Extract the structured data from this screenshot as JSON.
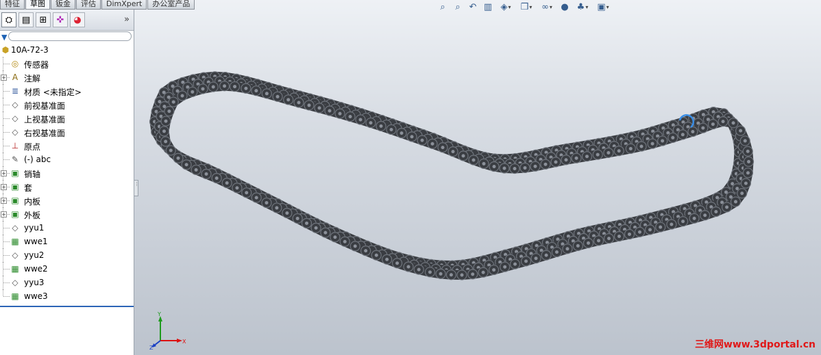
{
  "tabs": [
    {
      "label": "特征",
      "active": false
    },
    {
      "label": "草图",
      "active": true
    },
    {
      "label": "钣金",
      "active": false
    },
    {
      "label": "评估",
      "active": false
    },
    {
      "label": "DimXpert",
      "active": false
    },
    {
      "label": "办公室产品",
      "active": false
    }
  ],
  "panel": {
    "tab_icons": [
      "feature-manager-icon",
      "property-manager-icon",
      "configuration-manager-icon",
      "dimxpert-manager-icon",
      "display-manager-icon"
    ],
    "expand_glyph": "»",
    "tree": [
      {
        "label": "10A-72-3",
        "icon": "assembly-icon",
        "root": true
      },
      {
        "label": "传感器",
        "icon": "sensor-icon"
      },
      {
        "label": "注解",
        "icon": "annotation-icon",
        "expandable": true
      },
      {
        "label": "材质 <未指定>",
        "icon": "material-icon"
      },
      {
        "label": "前视基准面",
        "icon": "plane-icon"
      },
      {
        "label": "上视基准面",
        "icon": "plane-icon"
      },
      {
        "label": "右视基准面",
        "icon": "plane-icon"
      },
      {
        "label": "原点",
        "icon": "origin-icon"
      },
      {
        "label": "(-) abc",
        "icon": "sketch-icon"
      },
      {
        "label": "销轴",
        "icon": "part-icon",
        "expandable": true
      },
      {
        "label": "套",
        "icon": "part-icon",
        "expandable": true
      },
      {
        "label": "内板",
        "icon": "part-icon",
        "expandable": true
      },
      {
        "label": "外板",
        "icon": "part-icon",
        "expandable": true
      },
      {
        "label": "yyu1",
        "icon": "plane-icon"
      },
      {
        "label": "wwe1",
        "icon": "pattern-icon"
      },
      {
        "label": "yyu2",
        "icon": "plane-icon"
      },
      {
        "label": "wwe2",
        "icon": "pattern-icon"
      },
      {
        "label": "yyu3",
        "icon": "plane-icon"
      },
      {
        "label": "wwe3",
        "icon": "pattern-icon"
      }
    ]
  },
  "view_toolbar": [
    {
      "name": "zoom-to-fit-icon",
      "glyph": "⌕"
    },
    {
      "name": "zoom-to-area-icon",
      "glyph": "⌕"
    },
    {
      "name": "previous-view-icon",
      "glyph": "↶"
    },
    {
      "name": "section-view-icon",
      "glyph": "▥"
    },
    {
      "name": "view-orientation-icon",
      "glyph": "◈",
      "dropdown": true
    },
    {
      "name": "display-style-icon",
      "glyph": "❒",
      "dropdown": true
    },
    {
      "name": "hide-show-items-icon",
      "glyph": "∞",
      "dropdown": true
    },
    {
      "name": "edit-appearance-icon",
      "glyph": "●"
    },
    {
      "name": "apply-scene-icon",
      "glyph": "♣",
      "dropdown": true
    },
    {
      "name": "view-settings-icon",
      "glyph": "▣",
      "dropdown": true
    }
  ],
  "triad": {
    "x_label": "X",
    "y_label": "Y",
    "z_label": "Z"
  },
  "watermark": "三维网www.3dportal.cn",
  "colors": {
    "chain": "#3a3d42",
    "chain_highlight": "#6f747c",
    "selection": "#3a8ee6",
    "active_line": "#2b64b7"
  }
}
